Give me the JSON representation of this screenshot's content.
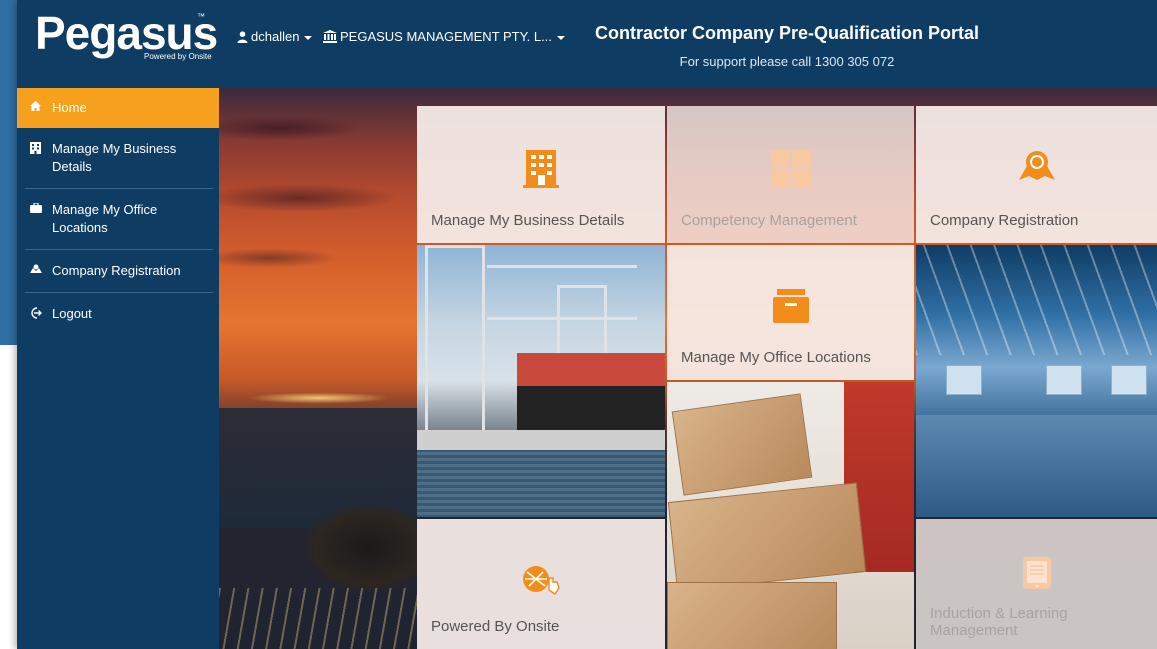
{
  "header": {
    "logo_text": "Pegasus",
    "logo_tm": "™",
    "logo_sub": "Powered by Onsite",
    "user_label": "dchallen",
    "org_label": "PEGASUS MANAGEMENT PTY. L...",
    "title": "Contractor Company Pre-Qualification Portal",
    "support": "For support please call 1300 305 072"
  },
  "sidebar": {
    "items": [
      {
        "label": "Home",
        "icon": "home-icon",
        "active": true
      },
      {
        "label": "Manage My Business Details",
        "icon": "building-icon"
      },
      {
        "label": "Manage My Office Locations",
        "icon": "briefcase-icon"
      },
      {
        "label": "Company Registration",
        "icon": "award-icon"
      },
      {
        "label": "Logout",
        "icon": "logout-icon"
      }
    ]
  },
  "tiles": [
    {
      "label": "Manage My Business Details",
      "icon": "building-icon",
      "state": "enabled"
    },
    {
      "label": "Competency Management",
      "icon": "grid-icon",
      "state": "disabled"
    },
    {
      "label": "Company Registration",
      "icon": "award-icon",
      "state": "enabled"
    },
    {
      "label": "Manage My Office Locations",
      "icon": "archive-box-icon",
      "state": "enabled"
    },
    {
      "label": "Powered By Onsite",
      "icon": "onsite-logo-icon",
      "state": "enabled"
    },
    {
      "label": "Induction & Learning Management",
      "icon": "tablet-icon",
      "state": "disabled"
    }
  ],
  "colors": {
    "navy": "#0e3c62",
    "accent_orange": "#f7a01d",
    "frame_blue": "#2f6fa3"
  }
}
